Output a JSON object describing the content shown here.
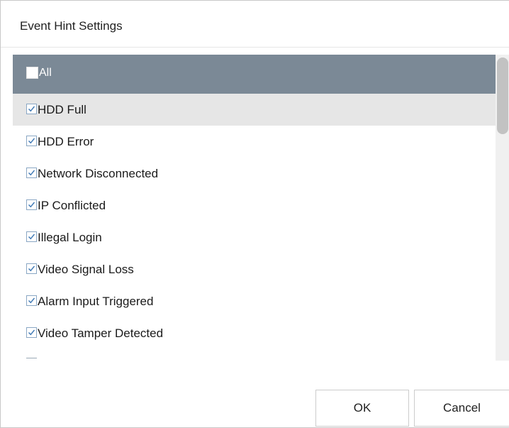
{
  "dialog": {
    "title": "Event Hint Settings",
    "all_label": "All",
    "items": [
      {
        "label": "HDD Full",
        "checked": true
      },
      {
        "label": "HDD Error",
        "checked": true
      },
      {
        "label": "Network Disconnected",
        "checked": true
      },
      {
        "label": "IP Conflicted",
        "checked": true
      },
      {
        "label": "Illegal Login",
        "checked": true
      },
      {
        "label": "Video Signal Loss",
        "checked": true
      },
      {
        "label": "Alarm Input Triggered",
        "checked": true
      },
      {
        "label": "Video Tamper Detected",
        "checked": true
      }
    ],
    "ok_label": "OK",
    "cancel_label": "Cancel"
  },
  "colors": {
    "header_bg": "#7b8996",
    "highlight_row": "#e6e6e6",
    "checkmark": "#3d78b5"
  }
}
